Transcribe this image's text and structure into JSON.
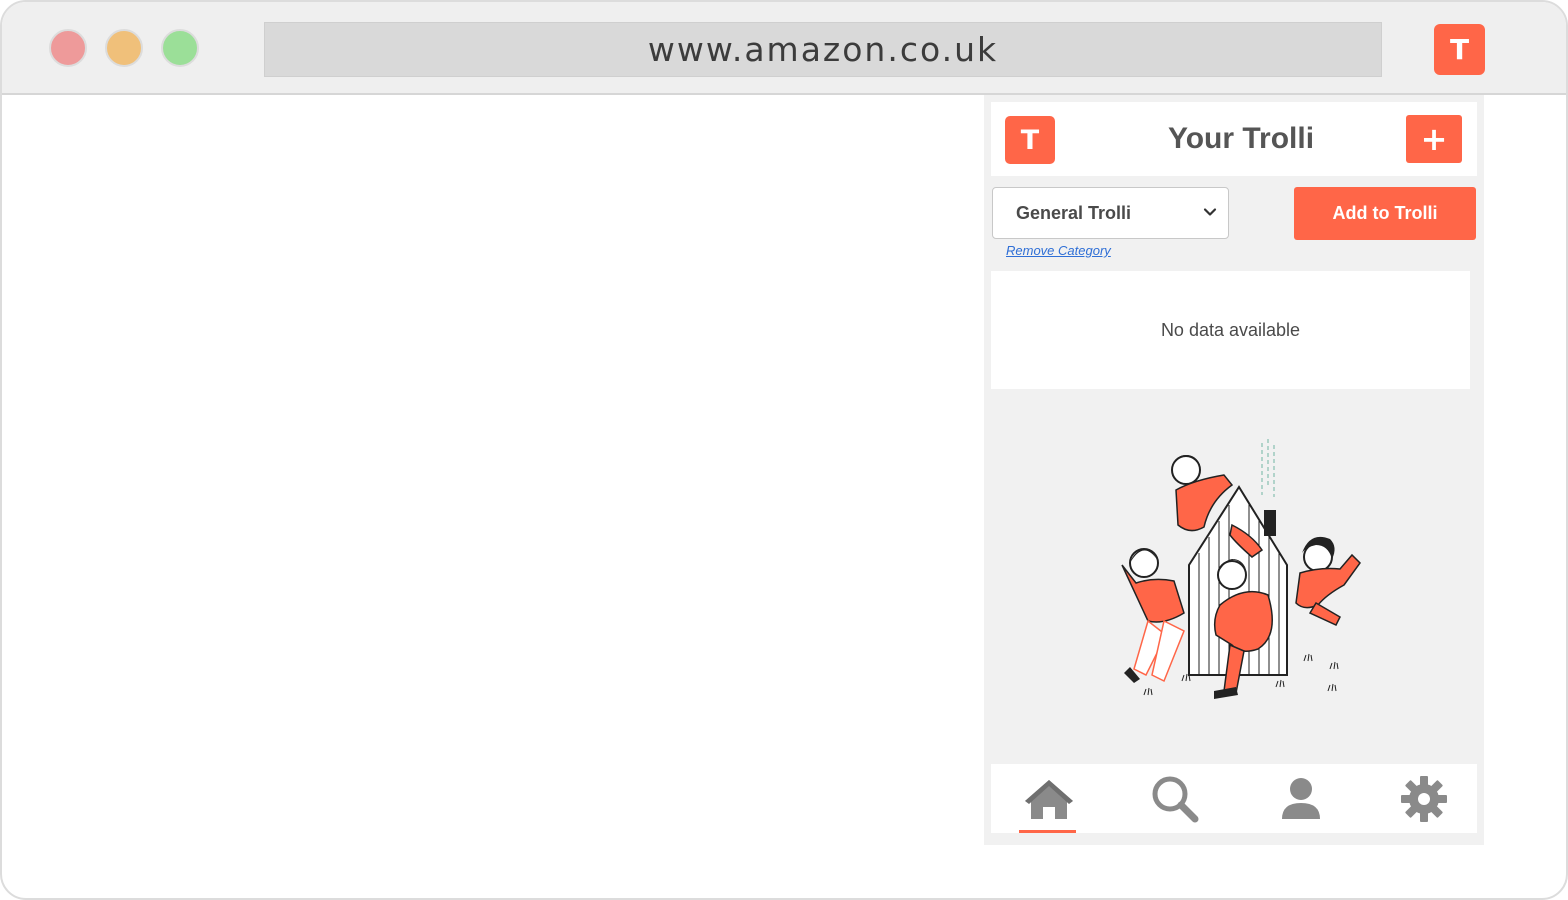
{
  "browser": {
    "url": "www.amazon.co.uk",
    "extension_button_label": "T",
    "traffic_lights": [
      "close",
      "minimize",
      "maximize"
    ]
  },
  "popup": {
    "logo_label": "T",
    "title": "Your Trolli",
    "add_category_label": "+",
    "category_select": {
      "selected": "General Trolli"
    },
    "add_button_label": "Add to Trolli",
    "remove_category_label": "Remove Category",
    "empty_message": "No data available",
    "illustration": "people-waving-around-house-illustration",
    "nav": {
      "items": [
        {
          "icon": "home-icon",
          "active": true
        },
        {
          "icon": "search-icon",
          "active": false
        },
        {
          "icon": "user-icon",
          "active": false
        },
        {
          "icon": "gear-icon",
          "active": false
        }
      ]
    }
  },
  "colors": {
    "accent": "#ff6648",
    "link": "#2f6fd6",
    "icon_gray": "#8a8a8a"
  }
}
